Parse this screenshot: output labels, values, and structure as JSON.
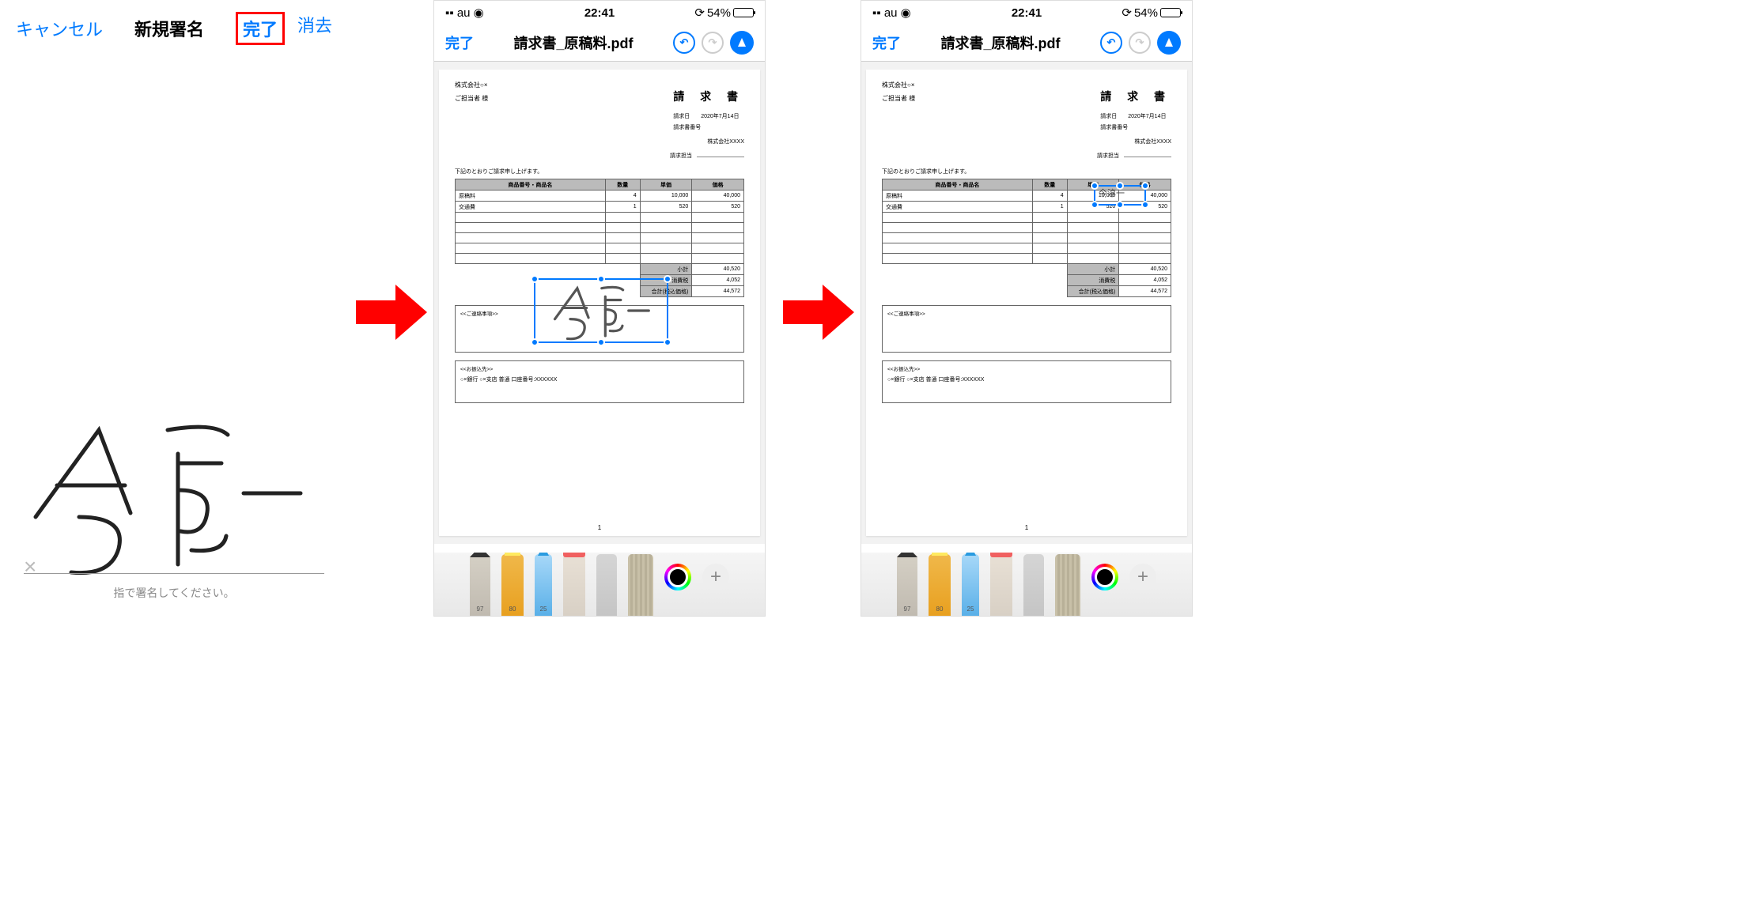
{
  "screen1": {
    "cancel": "キャンセル",
    "title": "新規署名",
    "done": "完了",
    "clear": "消去",
    "hint": "指で署名してください。"
  },
  "status": {
    "carrier": "au",
    "time": "22:41",
    "battery_pct": "54%"
  },
  "toolbar": {
    "done": "完了",
    "filename": "請求書_原稿料.pdf"
  },
  "doc": {
    "company": "株式会社○×",
    "attn": "ご担当者 様",
    "title": "請 求 書",
    "date_label": "請求日",
    "date_value": "2020年7月14日",
    "no_label": "請求書番号",
    "billto": "株式会社XXXX",
    "agent": "請求担当",
    "note": "下記のとおりご請求申し上げます。",
    "th_item": "商品番号・商品名",
    "th_qty": "数量",
    "th_unit": "単価",
    "th_price": "価格",
    "r1_item": "原稿料",
    "r1_qty": "4",
    "r1_unit": "10,000",
    "r1_price": "40,000",
    "r2_item": "交通費",
    "r2_qty": "1",
    "r2_unit": "520",
    "r2_price": "520",
    "subtotal_l": "小計",
    "subtotal_v": "40,520",
    "tax_l": "消費税",
    "tax_v": "4,052",
    "total_l": "合計(税込価格)",
    "total_v": "44,572",
    "memo": "<<ご連絡事項>>",
    "bank_h": "<<お振込先>>",
    "bank_v": "○×銀行 ○×支店 普通 口座番号:XXXXXX",
    "page": "1"
  },
  "tools": {
    "pencil": "97",
    "marker": "80",
    "pen": "25"
  },
  "sig_text": "今淳一"
}
